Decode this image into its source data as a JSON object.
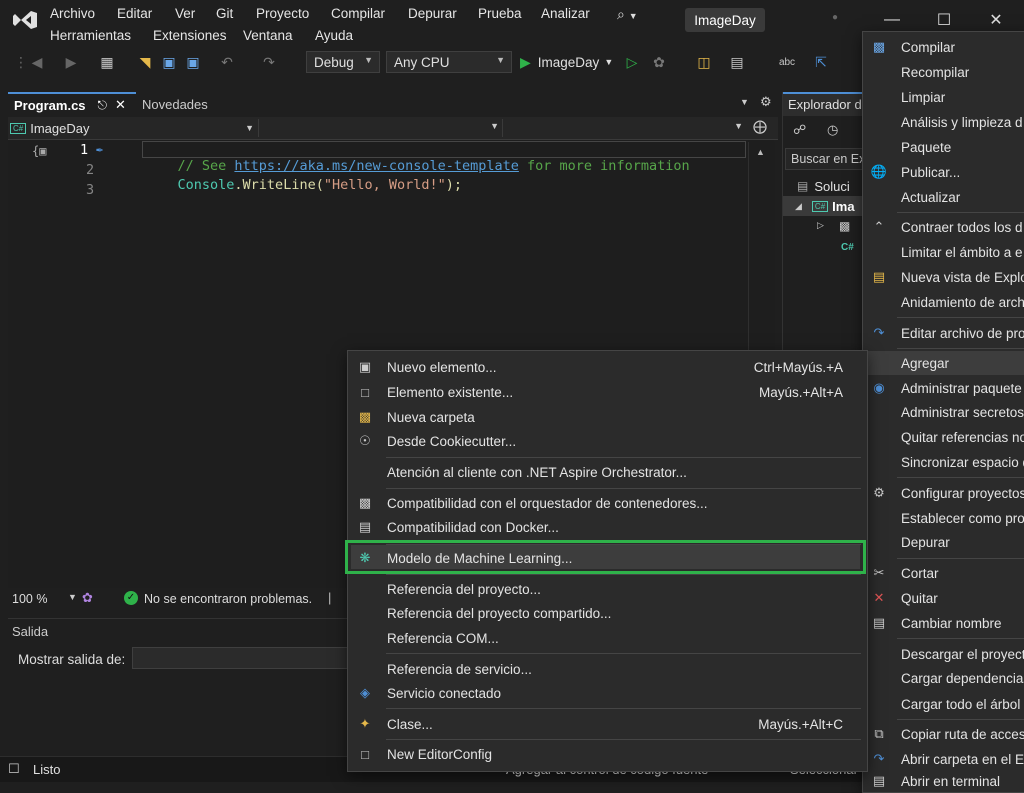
{
  "menu": [
    "Archivo",
    "Editar",
    "Ver",
    "Git",
    "Proyecto",
    "Compilar",
    "Depurar",
    "Prueba",
    "Analizar",
    "Herramientas",
    "Extensiones",
    "Ventana",
    "Ayuda"
  ],
  "solution_name": "ImageDay",
  "toolbar": {
    "config": "Debug",
    "platform": "Any CPU",
    "run_target": "ImageDay"
  },
  "tabs": {
    "active": "Program.cs",
    "other": "Novedades"
  },
  "navbar": {
    "project": "ImageDay"
  },
  "code": {
    "line_numbers": [
      "1",
      "2",
      "3"
    ],
    "line1_comment_start": "// See ",
    "line1_link": "https://aka.ms/new-console-template",
    "line1_comment_end": " for more information",
    "line2_class": "Console",
    "line2_method": ".WriteLine(",
    "line2_string": "\"Hello, World!\"",
    "line2_end": ");"
  },
  "editor_status": {
    "zoom": "100 %",
    "issues": "No se encontraron problemas."
  },
  "output": {
    "title": "Salida",
    "show_label": "Mostrar salida de:"
  },
  "solution_explorer": {
    "title": "Explorador d",
    "search": "Buscar en Ex",
    "solution_item": "Soluci",
    "project_item": "Ima"
  },
  "statusbar": {
    "ready": "Listo",
    "source_control": "Agregar al control de código fuente",
    "select_repo": "Seleccionar"
  },
  "add_menu": [
    {
      "label": "Nuevo elemento...",
      "shortcut": "Ctrl+Mayús.+A",
      "icon": "new-item-icon"
    },
    {
      "label": "Elemento existente...",
      "shortcut": "Mayús.+Alt+A",
      "icon": "existing-item-icon"
    },
    {
      "label": "Nueva carpeta",
      "shortcut": "",
      "icon": "folder-icon"
    },
    {
      "label": "Desde Cookiecutter...",
      "shortcut": "",
      "icon": "cookiecutter-icon"
    },
    {
      "label": "Atención al cliente con .NET Aspire Orchestrator...",
      "shortcut": "",
      "icon": ""
    },
    {
      "label": "Compatibilidad con el orquestador de contenedores...",
      "shortcut": "",
      "icon": "container-icon"
    },
    {
      "label": "Compatibilidad con Docker...",
      "shortcut": "",
      "icon": "docker-icon"
    },
    {
      "label": "Modelo de Machine Learning...",
      "shortcut": "",
      "icon": "ml-model-icon"
    },
    {
      "label": "Referencia del proyecto...",
      "shortcut": "",
      "icon": ""
    },
    {
      "label": "Referencia del proyecto compartido...",
      "shortcut": "",
      "icon": ""
    },
    {
      "label": "Referencia COM...",
      "shortcut": "",
      "icon": ""
    },
    {
      "label": "Referencia de servicio...",
      "shortcut": "",
      "icon": ""
    },
    {
      "label": "Servicio conectado",
      "shortcut": "",
      "icon": "connected-service-icon"
    },
    {
      "label": "Clase...",
      "shortcut": "Mayús.+Alt+C",
      "icon": "class-icon"
    },
    {
      "label": "New EditorConfig",
      "shortcut": "",
      "icon": "editorconfig-icon"
    }
  ],
  "project_menu": [
    {
      "label": "Compilar",
      "icon": "build-icon"
    },
    {
      "label": "Recompilar",
      "icon": ""
    },
    {
      "label": "Limpiar",
      "icon": ""
    },
    {
      "label": "Análisis y limpieza d",
      "icon": ""
    },
    {
      "label": "Paquete",
      "icon": ""
    },
    {
      "label": "Publicar...",
      "icon": "publish-icon"
    },
    {
      "label": "Actualizar",
      "icon": ""
    },
    {
      "label": "Contraer todos los d",
      "icon": "collapse-icon"
    },
    {
      "label": "Limitar el ámbito a e",
      "icon": ""
    },
    {
      "label": "Nueva vista de Explo",
      "icon": "new-view-icon"
    },
    {
      "label": "Anidamiento de arch",
      "icon": ""
    },
    {
      "label": "Editar archivo de pro",
      "icon": "edit-project-icon"
    },
    {
      "label": "Agregar",
      "icon": ""
    },
    {
      "label": "Administrar paquete",
      "icon": "nuget-icon"
    },
    {
      "label": "Administrar secretos",
      "icon": ""
    },
    {
      "label": "Quitar referencias no",
      "icon": ""
    },
    {
      "label": "Sincronizar espacio d",
      "icon": ""
    },
    {
      "label": "Configurar proyectos",
      "icon": "gear-icon"
    },
    {
      "label": "Establecer como pro",
      "icon": ""
    },
    {
      "label": "Depurar",
      "icon": ""
    },
    {
      "label": "Cortar",
      "icon": "cut-icon"
    },
    {
      "label": "Quitar",
      "icon": "remove-icon"
    },
    {
      "label": "Cambiar nombre",
      "icon": "rename-icon"
    },
    {
      "label": "Descargar el proyect",
      "icon": ""
    },
    {
      "label": "Cargar dependencias",
      "icon": ""
    },
    {
      "label": "Cargar todo el árbol",
      "icon": ""
    },
    {
      "label": "Copiar ruta de acces",
      "icon": "copy-path-icon"
    },
    {
      "label": "Abrir carpeta en el E",
      "icon": "open-folder-icon"
    },
    {
      "label": "Abrir en terminal",
      "icon": "terminal-icon"
    }
  ],
  "colors": {
    "accent_blue": "#4e8fd6",
    "highlight_green": "#2fb24a",
    "run_green": "#2fb24a",
    "comment_green": "#57a64a",
    "link_blue": "#569cd6",
    "string_orange": "#d69d85",
    "class_teal": "#4ec9b0"
  }
}
